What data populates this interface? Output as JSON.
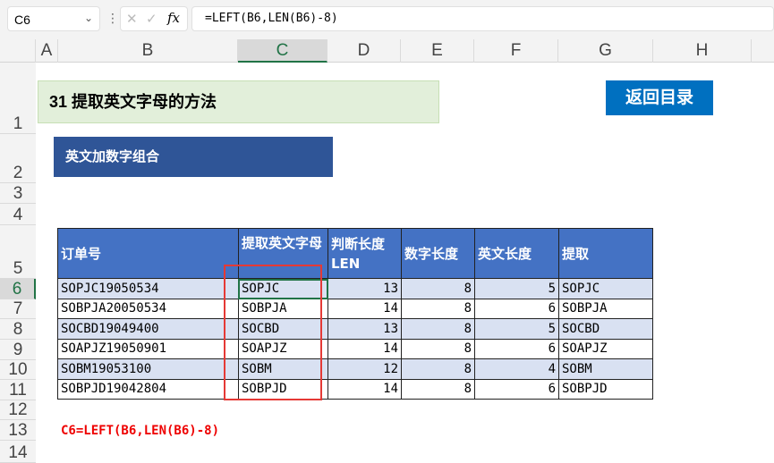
{
  "formula_bar": {
    "name_box": "C6",
    "formula": "=LEFT(B6,LEN(B6)-8)",
    "fx": "fx",
    "cancel": "✕",
    "confirm": "✓"
  },
  "columns": [
    "A",
    "B",
    "C",
    "D",
    "E",
    "F",
    "G",
    "H"
  ],
  "rows": [
    "1",
    "2",
    "3",
    "4",
    "5",
    "6",
    "7",
    "8",
    "9",
    "10",
    "11",
    "12",
    "13",
    "14"
  ],
  "title": "31 提取英文字母的方法",
  "back_button": "返回目录",
  "section": "英文加数字组合",
  "table": {
    "headers": [
      "订单号",
      "提取英文字母",
      "判断长度LEN",
      "数字长度",
      "英文长度",
      "提取"
    ],
    "rows": [
      [
        "SOPJC19050534",
        "SOPJC",
        "13",
        "8",
        "5",
        "SOPJC"
      ],
      [
        "SOBPJA20050534",
        "SOBPJA",
        "14",
        "8",
        "6",
        "SOBPJA"
      ],
      [
        "SOCBD19049400",
        "SOCBD",
        "13",
        "8",
        "5",
        "SOCBD"
      ],
      [
        "SOAPJZ19050901",
        "SOAPJZ",
        "14",
        "8",
        "6",
        "SOAPJZ"
      ],
      [
        "SOBM19053100",
        "SOBM",
        "12",
        "8",
        "4",
        "SOBM"
      ],
      [
        "SOBPJD19042804",
        "SOBPJD",
        "14",
        "8",
        "6",
        "SOBPJD"
      ]
    ]
  },
  "note": "C6=LEFT(B6,LEN(B6)-8)"
}
